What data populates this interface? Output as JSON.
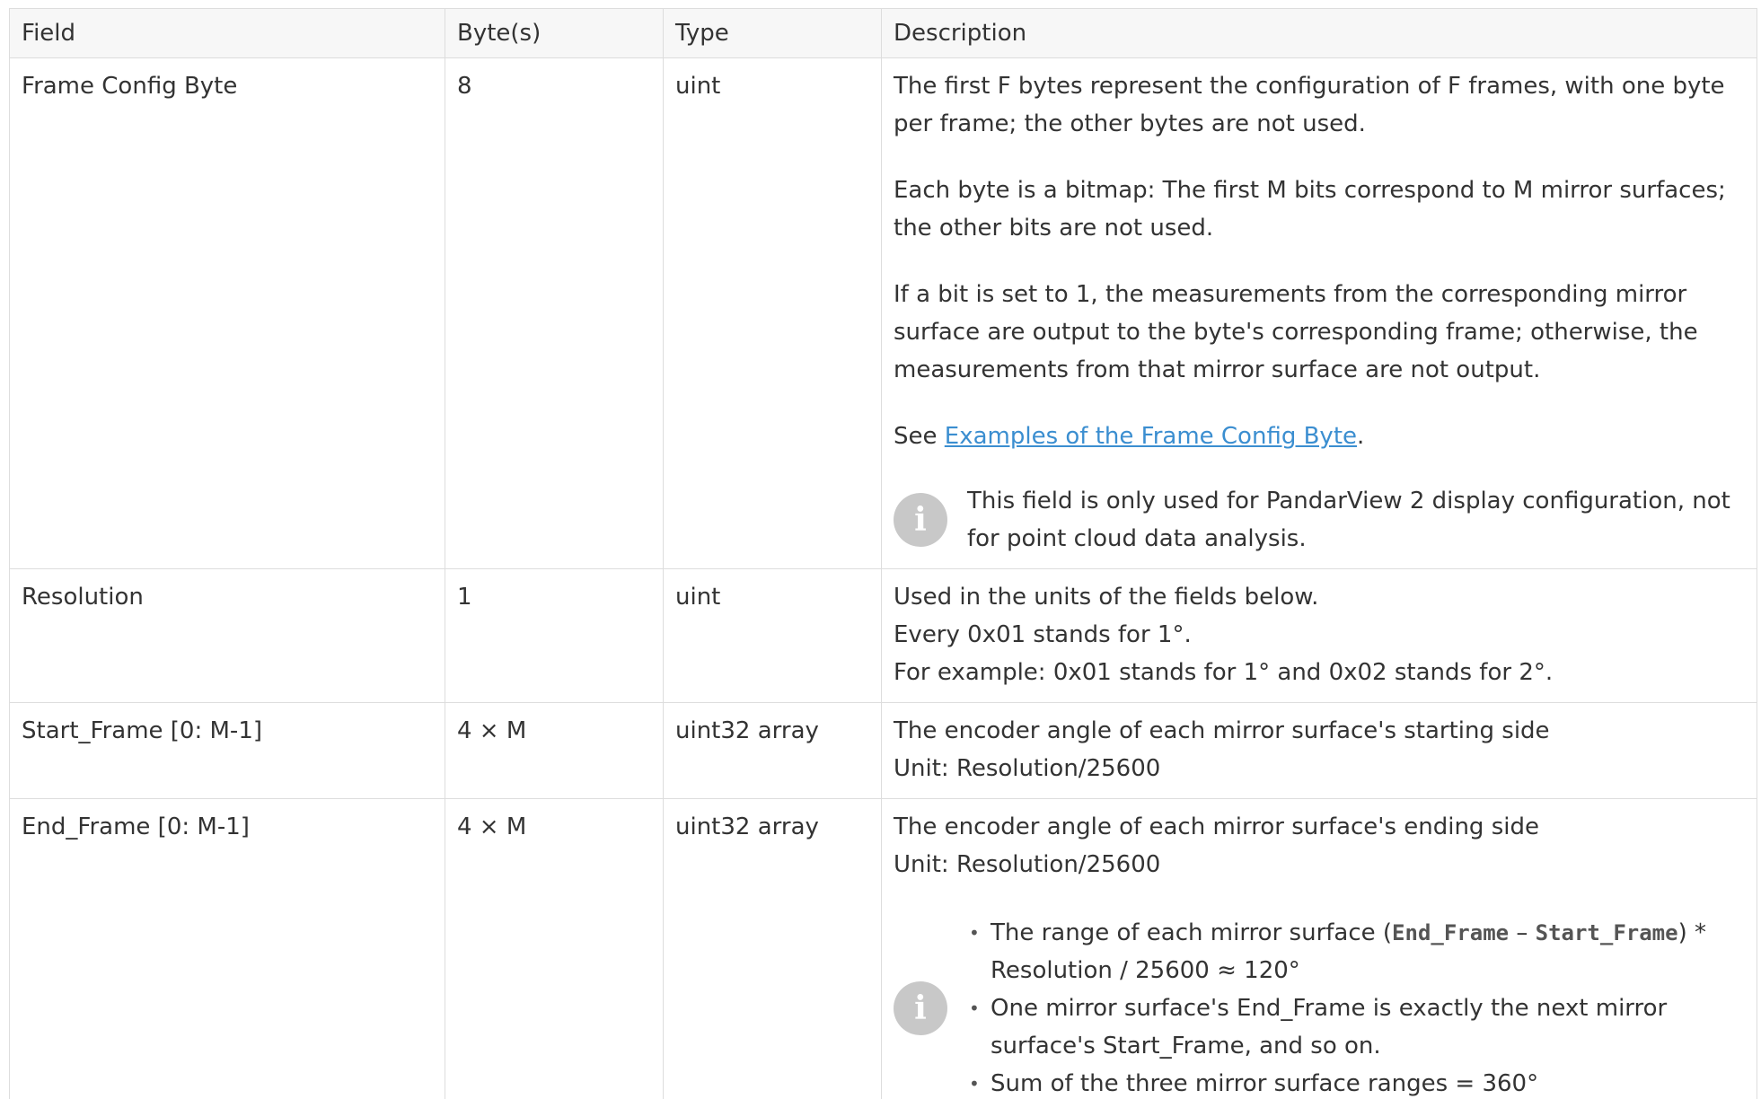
{
  "table": {
    "headers": {
      "field": "Field",
      "bytes": "Byte(s)",
      "type": "Type",
      "description": "Description"
    },
    "rows": [
      {
        "field": "Frame Config Byte",
        "bytes": "8",
        "type": "uint",
        "paragraphs": [
          "The first F bytes represent the configuration of F frames, with one byte per frame; the other bytes are not used.",
          "Each byte is a bitmap: The first M bits correspond to M mirror surfaces; the other bits are not used.",
          "If a bit is set to 1, the measurements from the corresponding mirror surface are output to the byte's corresponding frame; otherwise, the measurements from that mirror surface are not output."
        ],
        "see_prefix": "See ",
        "see_link": "Examples of the Frame Config Byte",
        "see_suffix": ".",
        "note": "This field is only used for PandarView 2 display configuration, not for point cloud data analysis."
      },
      {
        "field": "Resolution",
        "bytes": "1",
        "type": "uint",
        "lines": [
          "Used in the units of the fields below.",
          "Every 0x01 stands for 1°.",
          "For example: 0x01 stands for 1° and 0x02 stands for 2°."
        ]
      },
      {
        "field": "Start_Frame [0: M-1]",
        "bytes": "4 × M",
        "type": "uint32 array",
        "lines": [
          "The encoder angle of each mirror surface's starting side",
          "Unit: Resolution/25600"
        ]
      },
      {
        "field": "End_Frame [0: M-1]",
        "bytes": "4 × M",
        "type": "uint32 array",
        "lines": [
          "The encoder angle of each mirror surface's ending side",
          "Unit: Resolution/25600"
        ],
        "note_bullets": {
          "b1_prefix": "The range of each mirror surface (",
          "b1_code1": "End_Frame",
          "b1_dash": " – ",
          "b1_code2": "Start_Frame",
          "b1_suffix": ") * Resolution / 25600 ≈ 120°",
          "b2": "One mirror surface's End_Frame is exactly the next mirror surface's Start_Frame, and so on.",
          "b3": "Sum of the three mirror surface ranges = 360°"
        }
      }
    ]
  },
  "icons": {
    "info": "info-icon",
    "info_glyph": "i"
  }
}
